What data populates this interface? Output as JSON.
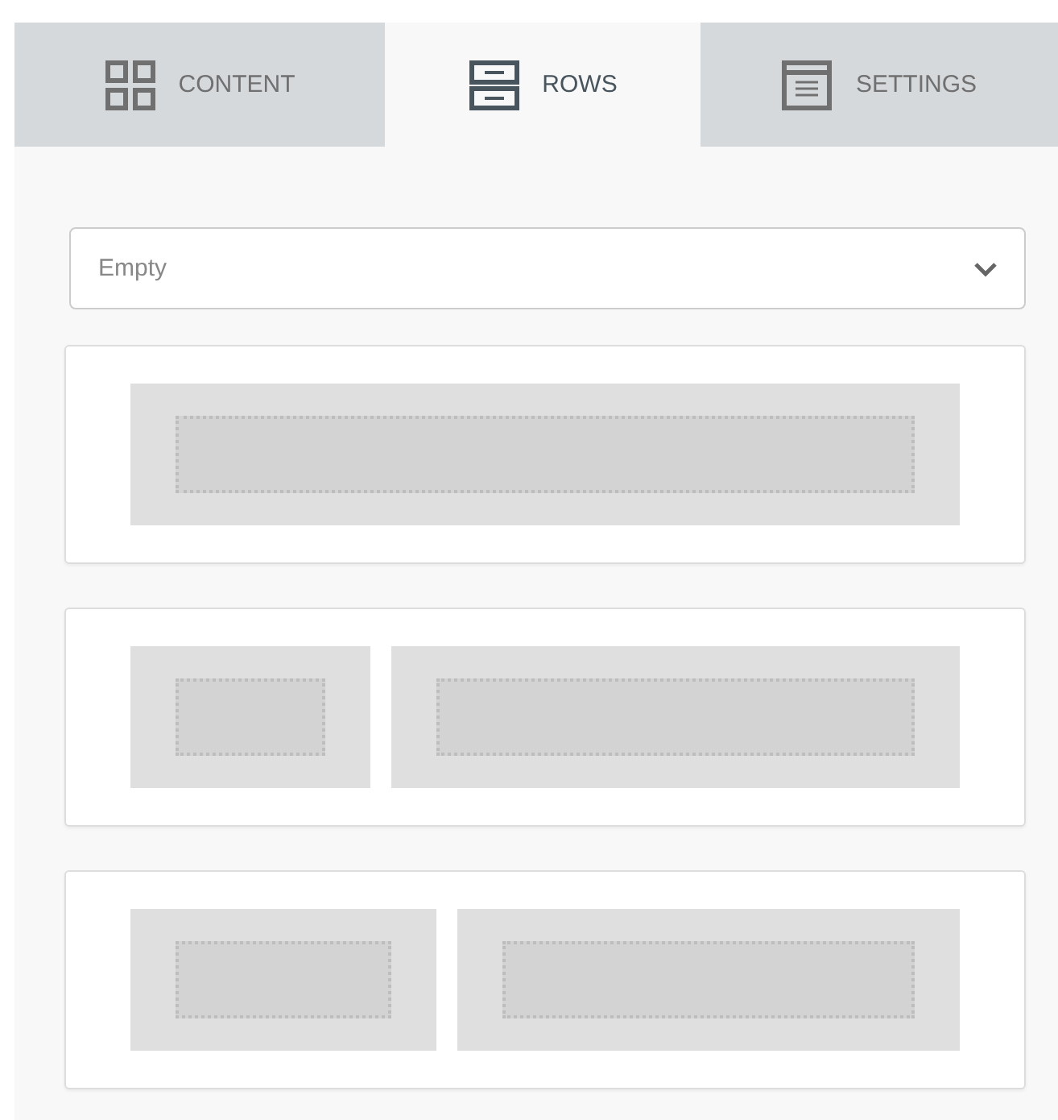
{
  "tabs": [
    {
      "label": "CONTENT",
      "kind": "grid",
      "selected": false
    },
    {
      "label": "ROWS",
      "kind": "rows",
      "selected": true
    },
    {
      "label": "SETTINGS",
      "kind": "doc",
      "selected": false
    }
  ],
  "select": {
    "value": "Empty"
  },
  "layouts": [
    {
      "columns": [
        {
          "kind": "full"
        }
      ]
    },
    {
      "columns": [
        {
          "kind": "quarter"
        },
        {
          "kind": "three-quarters"
        }
      ]
    },
    {
      "columns": [
        {
          "kind": "third"
        },
        {
          "kind": "two-thirds"
        }
      ]
    }
  ]
}
